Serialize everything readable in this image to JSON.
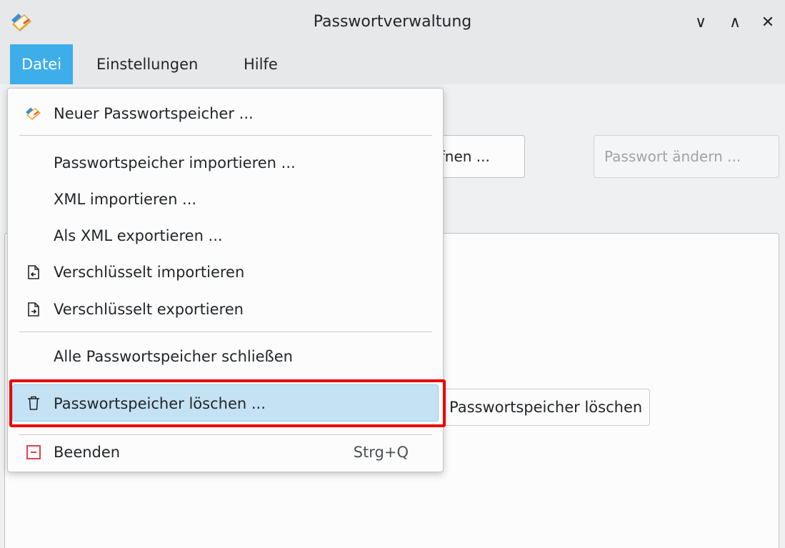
{
  "window": {
    "title": "Passwortverwaltung",
    "controls": {
      "minimize": "∨",
      "maximize": "∧",
      "close": "✕"
    }
  },
  "menubar": {
    "items": [
      {
        "label": "Datei",
        "active": true
      },
      {
        "label": "Einstellungen",
        "active": false
      },
      {
        "label": "Hilfe",
        "active": false
      }
    ]
  },
  "background": {
    "open_button_partial": "ffnen ...",
    "change_password_button": "Passwort ändern ..."
  },
  "dropdown": {
    "items": [
      {
        "label": "Neuer Passwortspeicher ...",
        "icon": "app-icon"
      },
      {
        "label": "Passwortspeicher importieren ...",
        "icon": ""
      },
      {
        "label": "XML importieren ...",
        "icon": ""
      },
      {
        "label": "Als XML exportieren ...",
        "icon": ""
      },
      {
        "label": "Verschlüsselt importieren",
        "icon": "document-import-icon"
      },
      {
        "label": "Verschlüsselt exportieren",
        "icon": "document-export-icon"
      },
      {
        "label": "Alle Passwortspeicher schließen",
        "icon": ""
      },
      {
        "label": "Passwortspeicher löschen ...",
        "icon": "trash-icon",
        "highlighted": true
      },
      {
        "label": "Beenden",
        "icon": "quit-icon",
        "shortcut": "Strg+Q"
      }
    ]
  },
  "tooltip": {
    "text": "Passwortspeicher löschen"
  },
  "colors": {
    "accent": "#3daee9",
    "highlight": "#c4e2f3",
    "annotation": "#ee0000",
    "quit_icon": "#da4453"
  }
}
